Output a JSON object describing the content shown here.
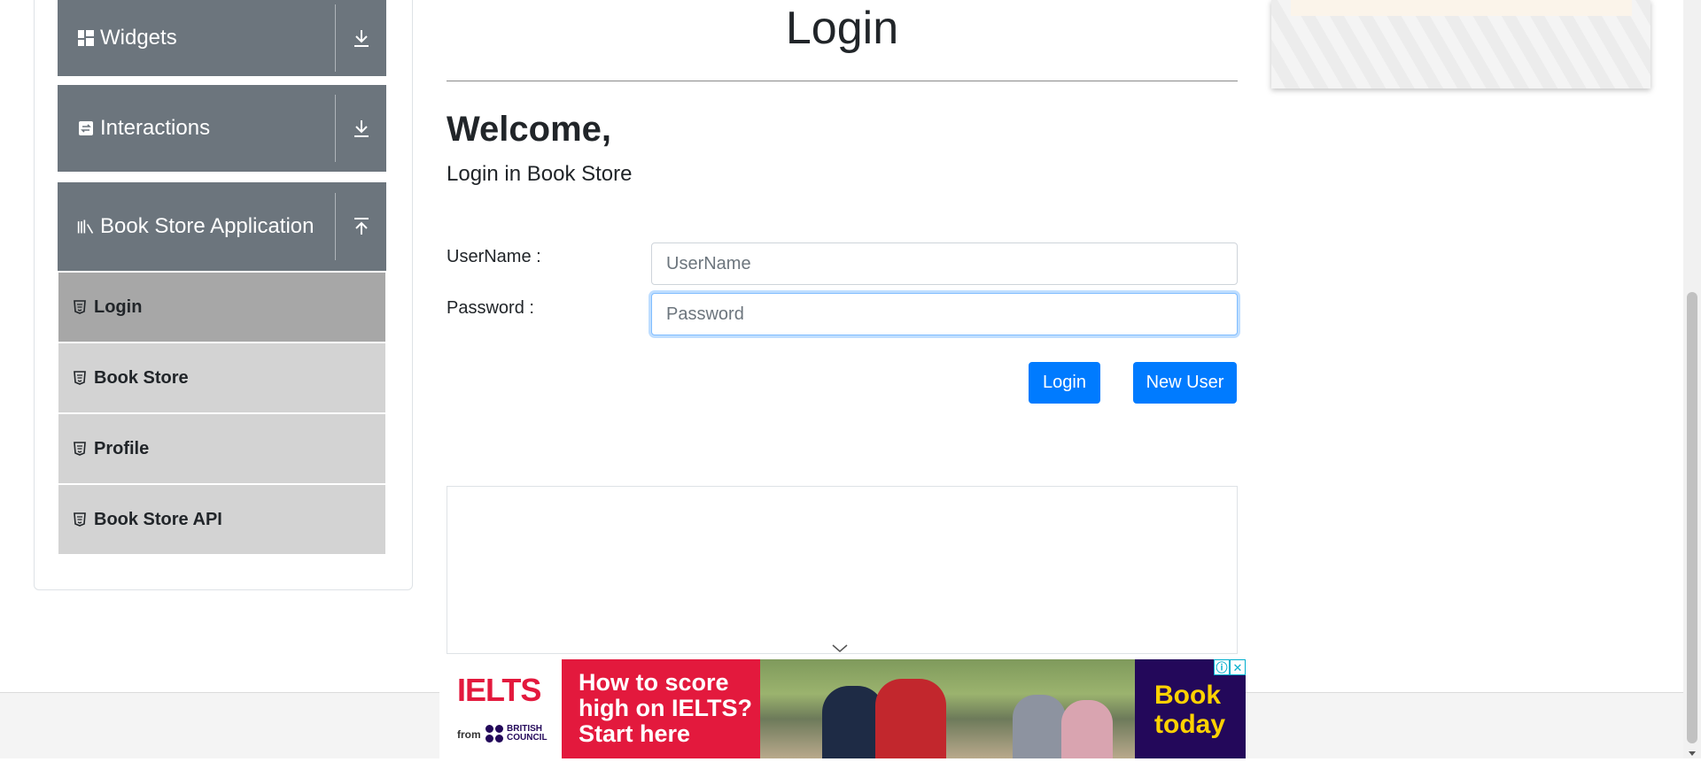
{
  "sidebar": {
    "groups": [
      {
        "label": "Widgets",
        "icon": "widgets-icon",
        "toggle": "download-arrow-icon"
      },
      {
        "label": "Interactions",
        "icon": "interactions-icon",
        "toggle": "download-arrow-icon"
      },
      {
        "label": "Book Store Application",
        "icon": "books-icon",
        "toggle": "upload-arrow-icon"
      }
    ],
    "items": [
      {
        "label": "Login",
        "icon": "html5-icon",
        "active": true
      },
      {
        "label": "Book Store",
        "icon": "html5-icon",
        "active": false
      },
      {
        "label": "Profile",
        "icon": "html5-icon",
        "active": false
      },
      {
        "label": "Book Store API",
        "icon": "html5-icon",
        "active": false
      }
    ]
  },
  "main": {
    "title": "Login",
    "welcome": "Welcome,",
    "subtitle": "Login in Book Store",
    "username_label": "UserName :",
    "username_placeholder": "UserName",
    "password_label": "Password :",
    "password_placeholder": "Password",
    "login_button": "Login",
    "new_user_button": "New User"
  },
  "ad": {
    "brand": "IELTS",
    "from": "from",
    "partner": "BRITISH COUNCIL",
    "headline": "How to score high on IELTS? Start here",
    "cta": "Book today",
    "info_icon": "ⓘ",
    "close_icon": "✕"
  },
  "colors": {
    "primary": "#007bff",
    "nav_header": "#6c757d",
    "nav_item": "#d3d3d3",
    "nav_item_active": "#a7a7a7",
    "ad_red": "#e3193d",
    "ad_purple": "#23085a",
    "ad_yellow": "#ffd200"
  }
}
